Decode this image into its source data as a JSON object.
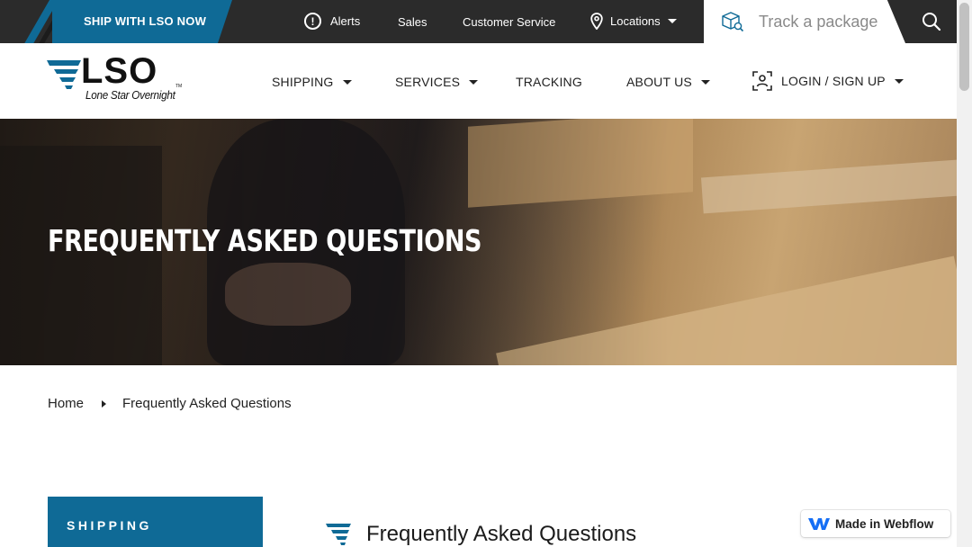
{
  "topbar": {
    "cta": "SHIP WITH LSO NOW",
    "alerts": "Alerts",
    "sales": "Sales",
    "customer_service": "Customer Service",
    "locations": "Locations",
    "track_placeholder": "Track a package"
  },
  "logo": {
    "wordmark": "LSO",
    "tagline": "Lone Star Overnight",
    "tm": "TM"
  },
  "nav": {
    "shipping": "SHIPPING",
    "services": "SERVICES",
    "tracking": "TRACKING",
    "about": "ABOUT US",
    "login": "LOGIN / SIGN UP"
  },
  "hero": {
    "title": "FREQUENTLY ASKED QUESTIONS"
  },
  "breadcrumb": {
    "home": "Home",
    "current": "Frequently Asked Questions"
  },
  "sidebar": {
    "active_tab": "SHIPPING"
  },
  "content": {
    "heading": "Frequently Asked Questions"
  },
  "badge": {
    "label": "Made in Webflow"
  },
  "colors": {
    "brand_blue": "#0f6a96",
    "topbar_bg": "#2b2b2b"
  }
}
